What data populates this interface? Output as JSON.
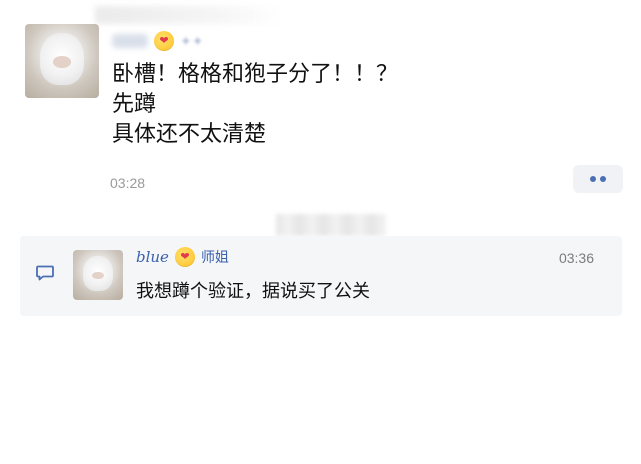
{
  "message_1": {
    "lines": [
      "卧槽！格格和狍子分了！！？",
      "先蹲",
      "具体还不太清楚"
    ],
    "time": "03:28"
  },
  "message_2": {
    "name": "blue",
    "title": "师姐",
    "time": "03:36",
    "text": "我想蹲个验证，据说买了公关"
  },
  "colors": {
    "accent": "#3a60ad",
    "quote_bg": "#f5f6f8",
    "more_bg": "#f0f2f6"
  },
  "icons": {
    "chat": "chat-bubble-icon",
    "more": "more-dots-icon",
    "emoji": "kiss-emoji-icon"
  }
}
